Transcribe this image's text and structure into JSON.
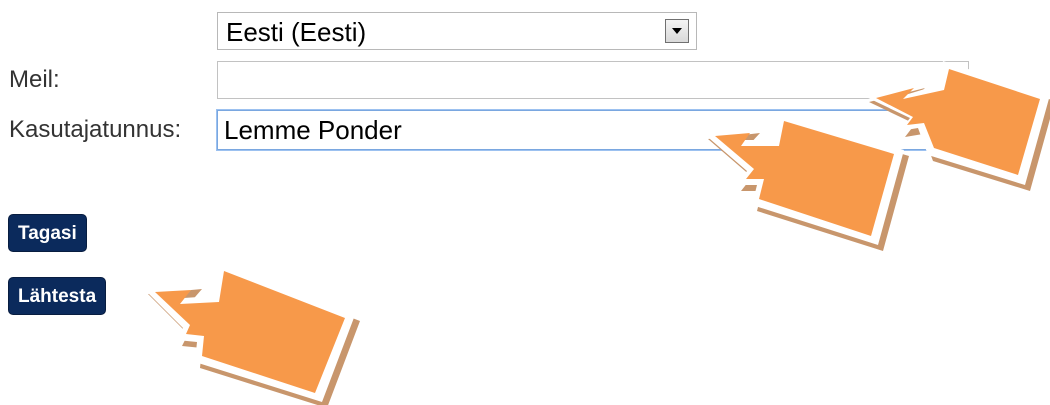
{
  "language_select": {
    "value": "Eesti (Eesti)"
  },
  "email": {
    "label": "Meil:",
    "value": ""
  },
  "username": {
    "label": "Kasutajatunnus:",
    "value": "Lemme Ponder"
  },
  "buttons": {
    "back": "Tagasi",
    "reset": "Lähtesta"
  },
  "colors": {
    "button_bg": "#0b2a5c",
    "arrow_fill": "#f7994a",
    "arrow_shadow": "#c8966c",
    "focus_border": "#7aa7e0"
  },
  "icons": {
    "dropdown": "chevron-down-icon",
    "annotation": "arrow-pointer-icon"
  }
}
